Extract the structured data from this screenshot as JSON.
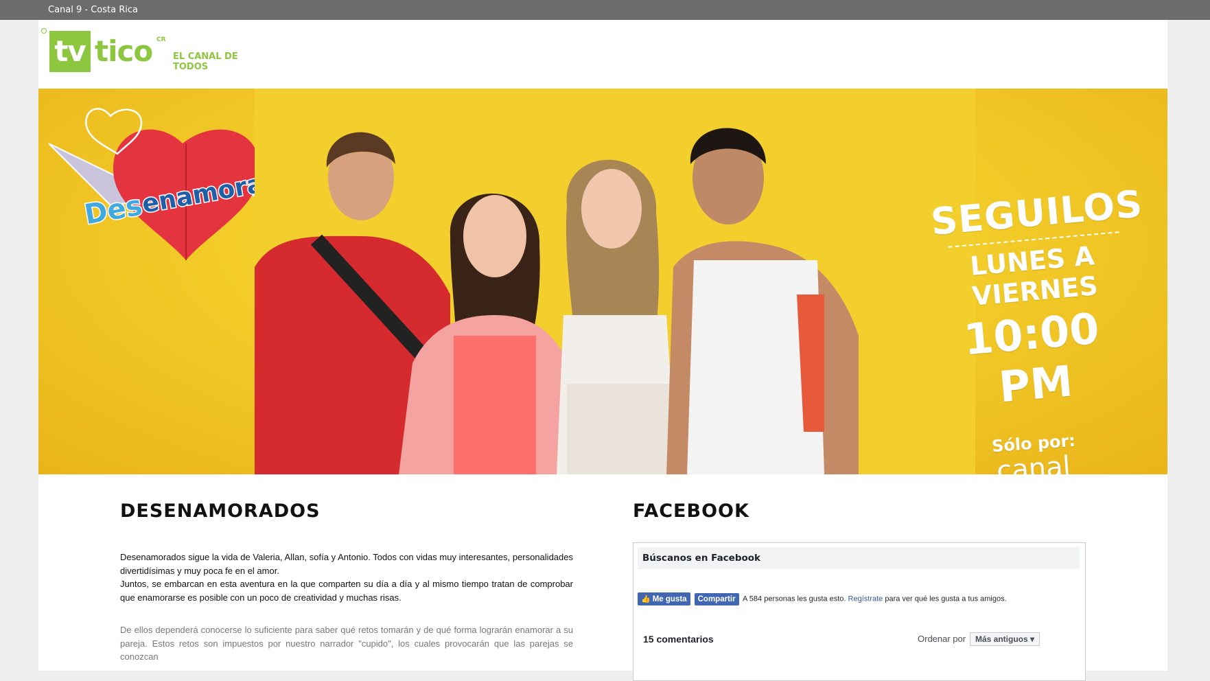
{
  "topbar": {
    "site_title": "Canal 9 - Costa Rica"
  },
  "logo": {
    "tv": "tv",
    "tico": "tico",
    "cr": "CR",
    "tagline": "EL CANAL DE TODOS",
    "brand_color": "#8dc63f"
  },
  "banner": {
    "show_title_part1": "Des",
    "show_title_part2": "enamorados",
    "promo_follow": "SEGUILOS",
    "promo_days": "LUNES A VIERNES",
    "promo_time": "10:00 PM",
    "promo_only": "Sólo por:",
    "promo_channel": "canal"
  },
  "about": {
    "heading": "DESENAMORADOS",
    "paragraph1": "Desenamorados sigue la vida de Valeria, Allan, sofía y Antonio. Todos con vidas muy interesantes, personalidades divertidísimas y muy poca fe en el amor.",
    "paragraph2": "Juntos, se embarcan en esta aventura en la que comparten su día a día y al mismo tiempo tratan de comprobar que enamorarse es posible con un poco de creatividad y muchas risas.",
    "paragraph3": "De ellos dependerá conocerse lo suficiente para saber qué retos tomarán y de qué forma lograrán enamorar a su pareja. Estos retos son impuestos por nuestro narrador \"cupido\", los cuales provocarán que las parejas se conozcan"
  },
  "facebook": {
    "heading": "FACEBOOK",
    "box_title": "Búscanos en Facebook",
    "like_label": "Me gusta",
    "share_label": "Compartir",
    "like_count_text": "A 584 personas les gusta esto.",
    "register_link": "Regístrate",
    "register_suffix": "para ver qué les gusta a tus amigos.",
    "comments_count": "15 comentarios",
    "order_label": "Ordenar por",
    "order_value": "Más antiguos ▾"
  }
}
